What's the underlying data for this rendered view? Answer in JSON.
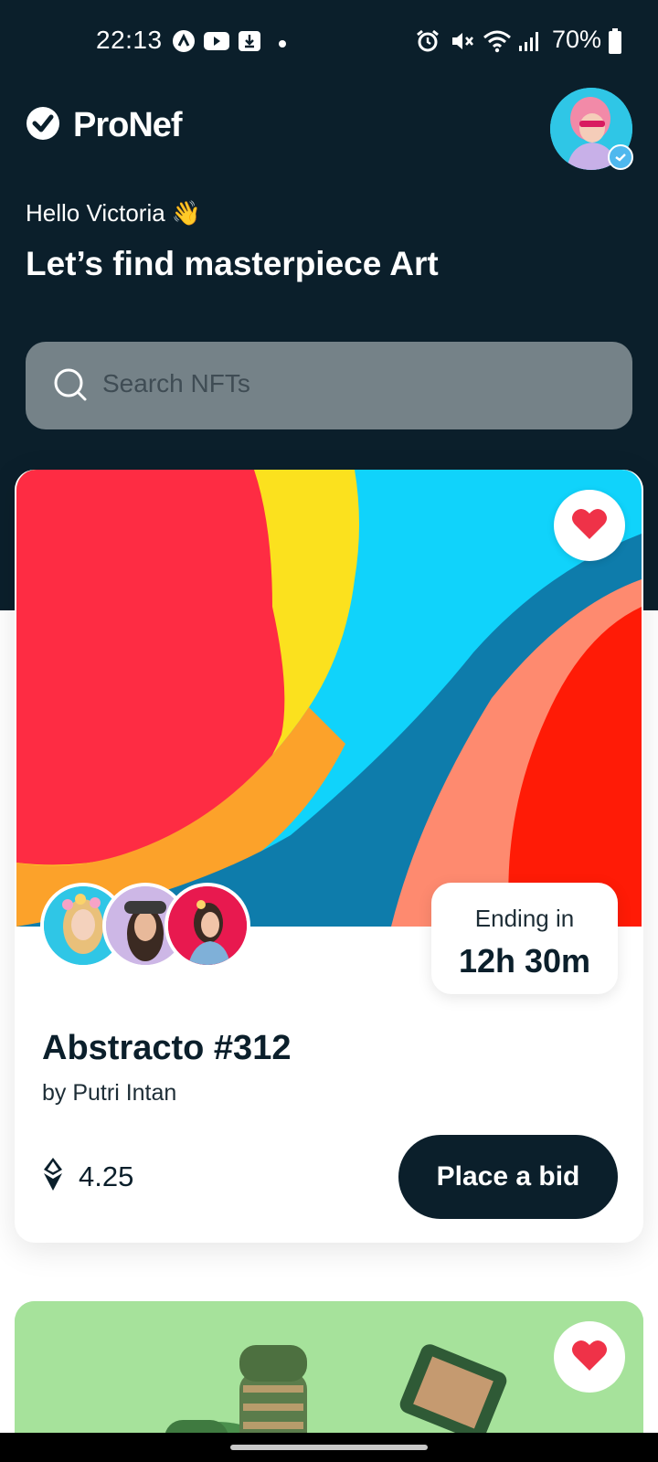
{
  "status_bar": {
    "time": "22:13",
    "battery": "70%",
    "icons": [
      "assistant-icon",
      "youtube-icon",
      "download-icon",
      "notification-dot",
      "alarm-icon",
      "mute-icon",
      "wifi-icon",
      "signal-icon",
      "battery-icon"
    ]
  },
  "header": {
    "app_name": "ProNef",
    "greeting": "Hello Victoria 👋",
    "headline": "Let’s find masterpiece Art"
  },
  "search": {
    "placeholder": "Search NFTs"
  },
  "cards": [
    {
      "ending_label": "Ending in",
      "ending_value": "12h 30m",
      "title": "Abstracto #312",
      "byline": "by Putri Intan",
      "price": "4.25",
      "bid_label": "Place a bid"
    }
  ],
  "colors": {
    "dark": "#0b1f2b",
    "heart": "#ef3248",
    "search_bg": "#758288",
    "art_red": "#fe2c43",
    "art_yellow": "#fbe11e",
    "art_cyan": "#10d3fb",
    "art_blue": "#0e7cab",
    "art_salmon": "#fe8a6f",
    "art_orange_red": "#ff1b06",
    "card2_green": "#a6e29b"
  }
}
